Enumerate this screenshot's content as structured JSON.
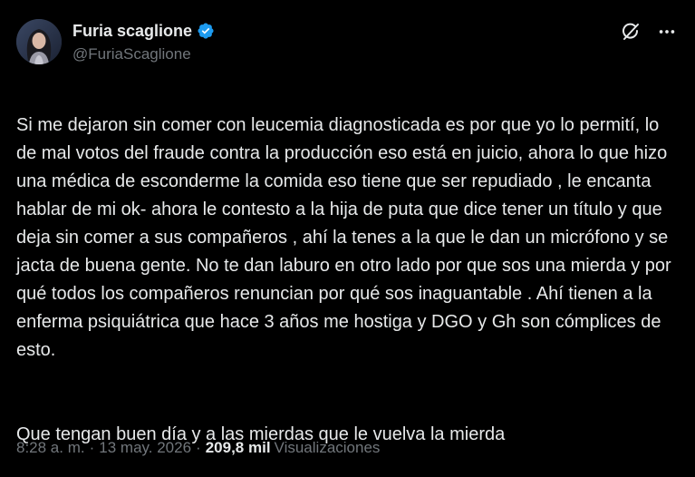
{
  "author": {
    "display_name": "Furia scaglione",
    "handle": "@FuriaScaglione",
    "verified": true,
    "verified_color": "#1d9bf0",
    "avatar_icon": "profile-photo-avatar"
  },
  "header_actions": {
    "grok_icon": "grok-icon",
    "more_icon": "more-horizontal-icon"
  },
  "tweet": {
    "paragraphs": [
      "Si me dejaron sin comer con leucemia diagnosticada es por que yo lo permití, lo de mal votos del fraude contra la producción eso está en juicio, ahora lo que hizo una médica de esconderme la comida eso tiene que ser repudiado , le encanta hablar de mi ok- ahora le contesto a la hija de puta que dice tener un título y que deja sin comer a sus compañeros , ahí la tenes a la que le dan un micrófono y se jacta de buena gente. No te dan laburo en otro lado por que sos una mierda y por qué todos los compañeros renuncian por qué sos inaguantable . Ahí tienen a la enferma psiquiátrica que hace 3 años me hostiga y DGO y Gh son cómplices de esto.",
      "Que tengan buen día y a las mierdas que le vuelva la mierda"
    ]
  },
  "meta": {
    "time": "8:28 a. m.",
    "separator": "·",
    "date": "13 may. 2026",
    "views_count": "209,8 mil",
    "views_label": "Visualizaciones"
  },
  "colors": {
    "background": "#000000",
    "text_primary": "#e7e9ea",
    "text_secondary": "#71767b"
  }
}
